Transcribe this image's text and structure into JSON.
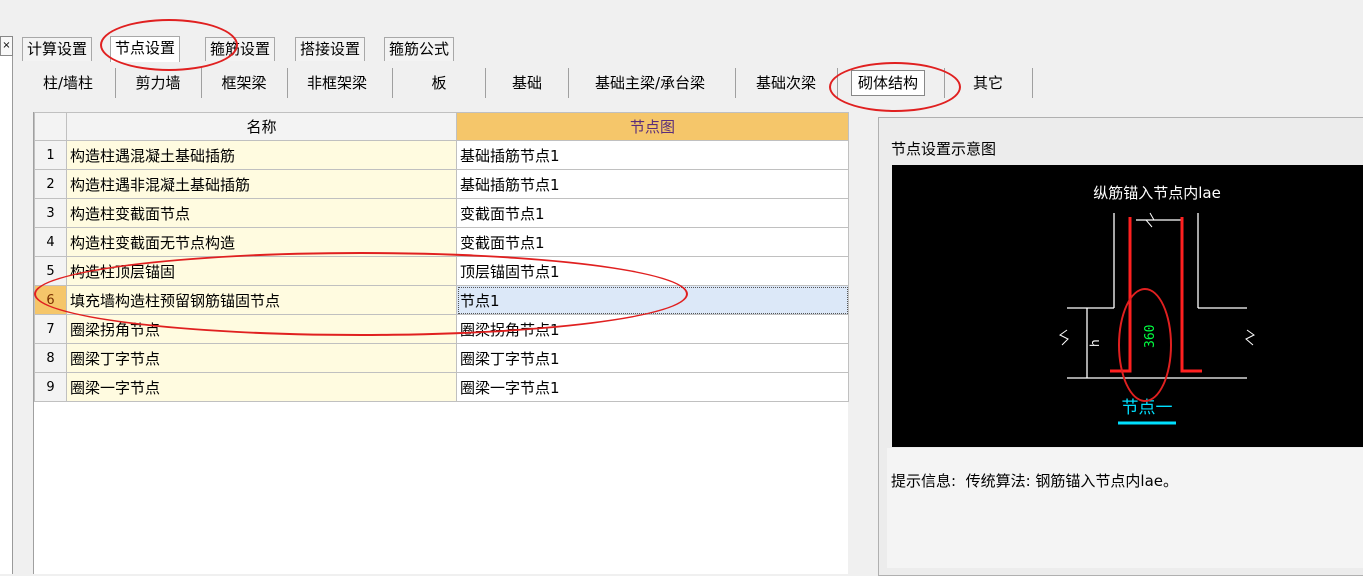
{
  "left_strip": {
    "close_glyph": "×"
  },
  "top_tabs": [
    "计算设置",
    "节点设置",
    "箍筋设置",
    "搭接设置",
    "箍筋公式"
  ],
  "active_top_tab": "节点设置",
  "sub_tabs": [
    "柱/墙柱",
    "剪力墙",
    "框架梁",
    "非框架梁",
    "板",
    "基础",
    "基础主梁/承台梁",
    "基础次梁",
    "砌体结构",
    "其它"
  ],
  "active_sub_tab": "砌体结构",
  "table": {
    "headers": {
      "name": "名称",
      "node": "节点图"
    },
    "rows": [
      {
        "idx": "1",
        "name": "构造柱遇混凝土基础插筋",
        "node": "基础插筋节点1"
      },
      {
        "idx": "2",
        "name": "构造柱遇非混凝土基础插筋",
        "node": "基础插筋节点1"
      },
      {
        "idx": "3",
        "name": "构造柱变截面节点",
        "node": "变截面节点1"
      },
      {
        "idx": "4",
        "name": "构造柱变截面无节点构造",
        "node": "变截面节点1"
      },
      {
        "idx": "5",
        "name": "构造柱顶层锚固",
        "node": "顶层锚固节点1"
      },
      {
        "idx": "6",
        "name": "填充墙构造柱预留钢筋锚固节点",
        "node": "节点1"
      },
      {
        "idx": "7",
        "name": "圈梁拐角节点",
        "node": "圈梁拐角节点1"
      },
      {
        "idx": "8",
        "name": "圈梁丁字节点",
        "node": "圈梁丁字节点1"
      },
      {
        "idx": "9",
        "name": "圈梁一字节点",
        "node": "圈梁一字节点1"
      }
    ],
    "selected_row": 6
  },
  "preview": {
    "title": "节点设置示意图",
    "diagram": {
      "top_label": "纵筋锚入节点内lae",
      "dim_label": "360",
      "side_label": "h",
      "caption": "节点一"
    },
    "tip_label": "提示信息:",
    "tip_text": "传统算法: 钢筋锚入节点内lae。"
  },
  "colors": {
    "annotation_red": "#e02020",
    "rebar_red": "#ff2020",
    "dim_green": "#00ff40",
    "caption_cyan": "#00e0ff",
    "header_orange": "#f5c66a"
  }
}
